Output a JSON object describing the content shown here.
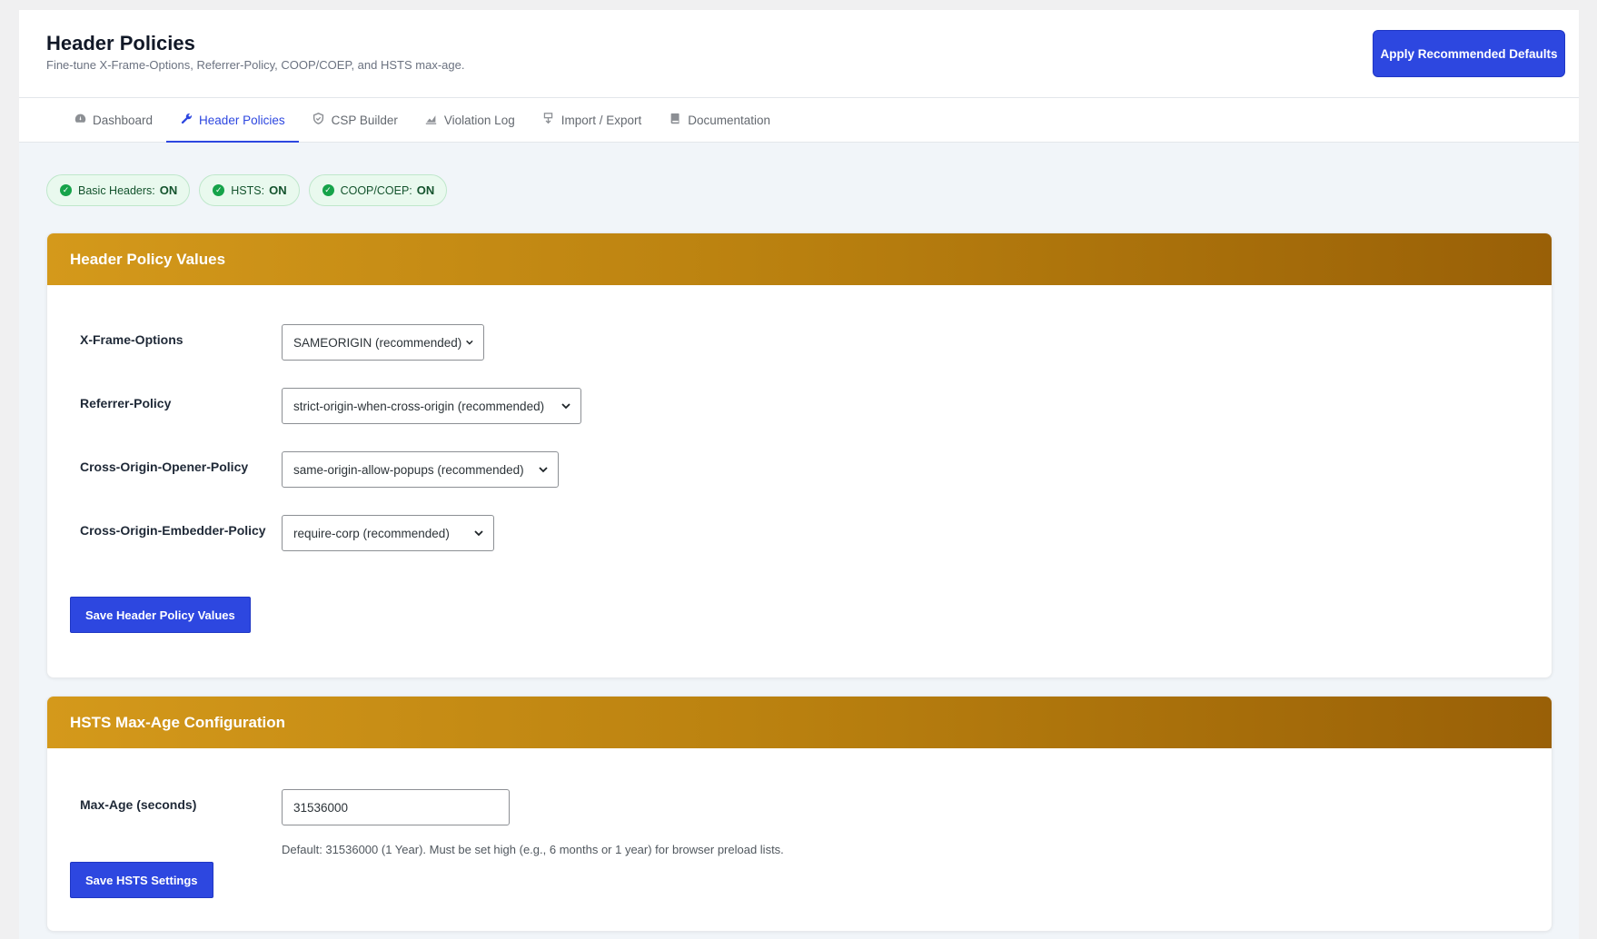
{
  "header": {
    "title": "Header Policies",
    "subtitle": "Fine-tune X-Frame-Options, Referrer-Policy, COOP/COEP, and HSTS max-age.",
    "apply_button": "Apply Recommended Defaults"
  },
  "tabs": [
    {
      "label": "Dashboard",
      "icon": "dashboard-icon",
      "active": false
    },
    {
      "label": "Header Policies",
      "icon": "wrench-icon",
      "active": true
    },
    {
      "label": "CSP Builder",
      "icon": "shield-icon",
      "active": false
    },
    {
      "label": "Violation Log",
      "icon": "chart-icon",
      "active": false
    },
    {
      "label": "Import / Export",
      "icon": "transfer-icon",
      "active": false
    },
    {
      "label": "Documentation",
      "icon": "book-icon",
      "active": false
    }
  ],
  "badges": [
    {
      "label": "Basic Headers:",
      "state": "ON"
    },
    {
      "label": "HSTS:",
      "state": "ON"
    },
    {
      "label": "COOP/COEP:",
      "state": "ON"
    }
  ],
  "policy_card": {
    "title": "Header Policy Values",
    "fields": [
      {
        "label": "X-Frame-Options",
        "value": "SAMEORIGIN (recommended)"
      },
      {
        "label": "Referrer-Policy",
        "value": "strict-origin-when-cross-origin (recommended)"
      },
      {
        "label": "Cross-Origin-Opener-Policy",
        "value": "same-origin-allow-popups (recommended)"
      },
      {
        "label": "Cross-Origin-Embedder-Policy",
        "value": "require-corp (recommended)"
      }
    ],
    "save_button": "Save Header Policy Values"
  },
  "hsts_card": {
    "title": "HSTS Max-Age Configuration",
    "field_label": "Max-Age (seconds)",
    "field_value": "31536000",
    "help": "Default: 31536000 (1 Year). Must be set high (e.g., 6 months or 1 year) for browser preload lists.",
    "save_button": "Save HSTS Settings"
  },
  "colors": {
    "accent": "#2d47e0",
    "card_header_start": "#d4991b",
    "card_header_end": "#996007",
    "badge_bg": "#e9f9ee",
    "badge_check": "#16a34a"
  }
}
